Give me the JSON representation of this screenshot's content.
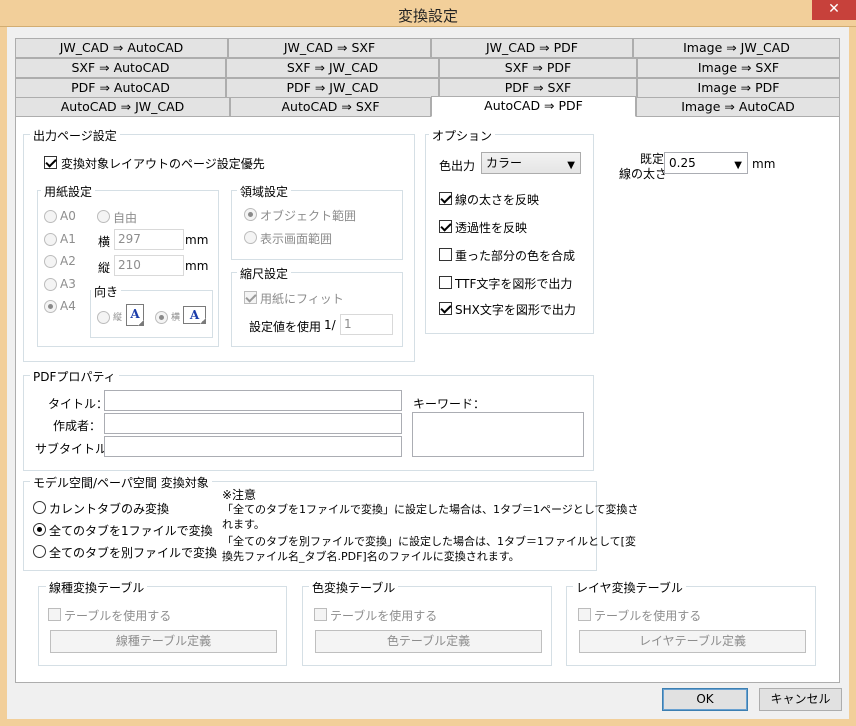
{
  "window": {
    "title": "変換設定",
    "close_glyph": "✕"
  },
  "tabs": {
    "row1": [
      "JW_CAD ⇒ AutoCAD",
      "JW_CAD ⇒ SXF",
      "JW_CAD ⇒ PDF",
      "Image ⇒ JW_CAD"
    ],
    "row2": [
      "SXF ⇒ AutoCAD",
      "SXF ⇒ JW_CAD",
      "SXF ⇒ PDF",
      "Image ⇒ SXF"
    ],
    "row3": [
      "PDF ⇒ AutoCAD",
      "PDF ⇒ JW_CAD",
      "PDF ⇒ SXF",
      "Image ⇒ PDF"
    ],
    "row4": [
      "AutoCAD ⇒ JW_CAD",
      "AutoCAD ⇒ SXF",
      "AutoCAD ⇒ PDF",
      "Image ⇒ AutoCAD"
    ],
    "active": "AutoCAD ⇒ PDF"
  },
  "output_page": {
    "legend": "出力ページ設定",
    "layout_priority": {
      "label": "変換対象レイアウトのページ設定優先",
      "checked": true
    },
    "paper": {
      "legend": "用紙設定",
      "sizes": [
        "A0",
        "A1",
        "A2",
        "A3",
        "A4"
      ],
      "selected": "A4",
      "free": "自由",
      "width_label": "横",
      "width_value": "297",
      "height_label": "縦",
      "height_value": "210",
      "unit": "mm",
      "orientation": {
        "legend": "向き",
        "portrait": "縦",
        "landscape": "横",
        "selected": "横",
        "icon_letter": "A"
      }
    },
    "area": {
      "legend": "領域設定",
      "options": [
        "オブジェクト範囲",
        "表示画面範囲"
      ],
      "selected": "オブジェクト範囲"
    },
    "scale": {
      "legend": "縮尺設定",
      "fit_label": "用紙にフィット",
      "fit_checked": true,
      "use_value_label": "設定値を使用",
      "prefix": "1/",
      "value": "1"
    }
  },
  "options": {
    "legend": "オプション",
    "color_label": "色出力",
    "color_value": "カラー",
    "items": [
      {
        "label": "線の太さを反映",
        "checked": true
      },
      {
        "label": "透過性を反映",
        "checked": true
      },
      {
        "label": "重った部分の色を合成",
        "checked": false
      },
      {
        "label": "TTF文字を図形で出力",
        "checked": false
      },
      {
        "label": "SHX文字を図形で出力",
        "checked": true
      }
    ]
  },
  "default_line_width": {
    "label_line1": "既定",
    "label_line2": "線の太さ",
    "value": "0.25",
    "unit": "mm"
  },
  "pdf_properties": {
    "legend": "PDFプロパティ",
    "title_label": "タイトル：",
    "author_label": "作成者：",
    "subtitle_label": "サブタイトル：",
    "keyword_label": "キーワード：",
    "title_value": "",
    "author_value": "",
    "subtitle_value": "",
    "keyword_value": ""
  },
  "model_paper": {
    "legend": "モデル空間/ペーパ空間  変換対象",
    "options": [
      "カレントタブのみ変換",
      "全てのタブを1ファイルで変換",
      "全てのタブを別ファイルで変換"
    ],
    "selected": "全てのタブを1ファイルで変換",
    "note_title": "※注意",
    "note_line1": "「全てのタブを1ファイルで変換」に設定した場合は、1タブ＝1ページとして変換さ",
    "note_line2": "れます。",
    "note_line3": "「全てのタブを別ファイルで変換」に設定した場合は、1タブ＝1ファイルとして[変",
    "note_line4": "換先ファイル名_タブ名.PDF]名のファイルに変換されます。"
  },
  "tables": [
    {
      "legend": "線種変換テーブル",
      "use_label": "テーブルを使用する",
      "button": "線種テーブル定義"
    },
    {
      "legend": "色変換テーブル",
      "use_label": "テーブルを使用する",
      "button": "色テーブル定義"
    },
    {
      "legend": "レイヤ変換テーブル",
      "use_label": "テーブルを使用する",
      "button": "レイヤテーブル定義"
    }
  ],
  "buttons": {
    "ok": "OK",
    "cancel": "キャンセル"
  }
}
